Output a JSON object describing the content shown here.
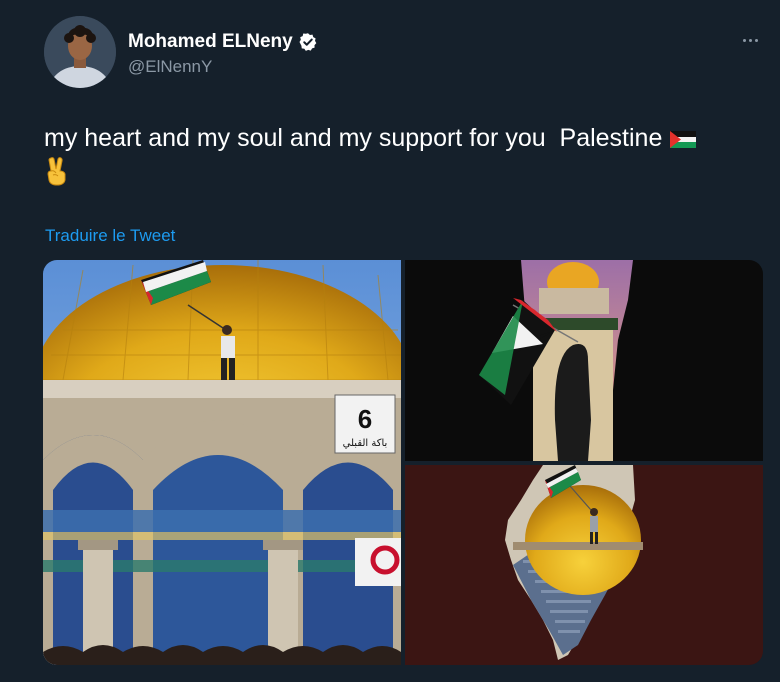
{
  "author": {
    "display_name": "Mohamed ELNeny",
    "handle": "@ElNennY",
    "verified": true
  },
  "tweet": {
    "text_line1": "my heart and my soul and my support for you  Palestine",
    "emoji_flag": "palestine-flag",
    "emoji_second": "victory-hand",
    "translate_label": "Traduire le Tweet"
  },
  "media": {
    "images": [
      {
        "description_icon": "photo",
        "sign_text": "6",
        "sign_caption": "باكة القبلي"
      },
      {
        "description_icon": "photo"
      },
      {
        "description_icon": "photo"
      }
    ]
  },
  "colors": {
    "background": "#15202b",
    "link": "#1d9bf0",
    "secondary_text": "#8b98a5",
    "verified_badge": "#ffffff"
  }
}
